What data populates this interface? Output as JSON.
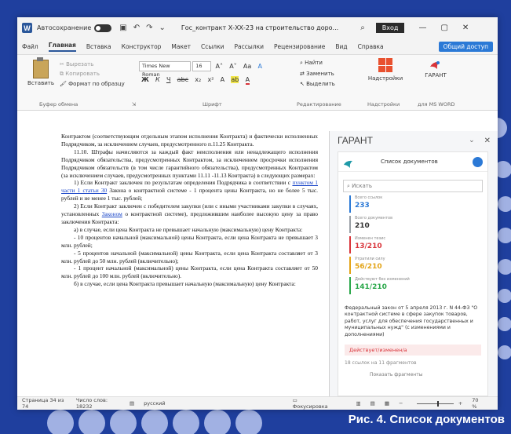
{
  "title_bar": {
    "autosave_label": "Автосохранение",
    "doc_title": "Гос_контракт Х-ХХ-23 на строительство доро...",
    "login_label": "Вход"
  },
  "menu": {
    "items": [
      "Файл",
      "Главная",
      "Вставка",
      "Конструктор",
      "Макет",
      "Ссылки",
      "Рассылки",
      "Рецензирование",
      "Вид",
      "Справка"
    ],
    "share_label": "Общий доступ"
  },
  "ribbon": {
    "paste_label": "Вставить",
    "cut_label": "Вырезать",
    "copy_label": "Копировать",
    "format_painter_label": "Формат по образцу",
    "font_name": "Times New Roman",
    "font_size": "16",
    "find_label": "Найти",
    "replace_label": "Заменить",
    "select_label": "Выделить",
    "addins_label": "Надстройки",
    "garant_label": "ГАРАНТ",
    "groups": {
      "clipboard": "Буфер обмена",
      "font": "Шрифт",
      "editing": "Редактирование",
      "addins": "Надстройки",
      "garant": "для MS WORD"
    }
  },
  "document": {
    "paragraphs": [
      "Контрактом (соответствующим отдельным этапом исполнения Контракта) и фактически исполненных Подрядчиком, за исключением случаев, предусмотренного п.11.25 Контракта.",
      "11.10. Штрафы начисляются за каждый факт неисполнения или ненадлежащего исполнения Подрядчиком обязательства, предусмотренных Контрактом, за исключением просрочки исполнения Подрядчиком обязательств (в том числе гарантийного обязательства), предусмотренных Контрактом (за исключением случаев, предусмотренных пунктами 11.11 -11.13 Контракта) в следующих размерах:",
      "1) Если Контракт заключен по результатам определения Подрядчика в соответствии с",
      "пунктом 1 части 1 статьи 30",
      " Закона о контрактной системе - 1 процента цены Контракта, но не более 5 тыс. рублей и не менее 1 тыс. рублей;",
      "2) Если Контракт заключен с победителем закупки (или с иными участниками закупки в случаях, установленных ",
      "Законом",
      " о контрактной системе), предложившим наиболее высокую цену за право заключения Контракта:",
      "а) в случае, если цена Контракта не превышает начальную (максимальную) цену Контракта:",
      "- 10 процентов начальной (максимальной) цены Контракта, если цена Контракта не превышает 3 млн. рублей;",
      "- 5 процентов начальной (максимальной) цены Контракта, если цена Контракта составляет от 3 млн. рублей до 50 млн. рублей (включительно);",
      "- 1 процент начальной (максимальной) цены Контракта, если цена Контракта составляет от 50 млн. рублей до 100 млн. рублей (включительно).",
      "б) в случае, если цена Контракта превышает начальную (максимальную) цену Контракта:"
    ]
  },
  "garant_panel": {
    "title": "ГАРАНТ",
    "card_title": "Список документов",
    "search_placeholder": "Искать",
    "stats": [
      {
        "label": "Всего ссылок",
        "value": "233",
        "color": "#2b79d6"
      },
      {
        "label": "Всего документов",
        "value": "210",
        "color": "#9aa0a6"
      },
      {
        "label": "Изменен тезис",
        "value": "13/210",
        "color": "#d9343a"
      },
      {
        "label": "Утратили силу",
        "value": "56/210",
        "color": "#e3a417"
      },
      {
        "label": "Действуют без изменений",
        "value": "141/210",
        "color": "#2aa84a"
      }
    ],
    "description": "Федеральный закон от 5 апреля 2013 г. N 44-ФЗ \"О контрактной системе в сфере закупок товаров, работ, услуг для обеспечения государственных и муниципальных нужд\" (с изменениями и дополнениями)",
    "action_label": "Действует/изменен/а",
    "count_label": "18 ссылок на 11 фрагментов",
    "more_label": "Показать фрагменты"
  },
  "status_bar": {
    "page": "Страница 34 из 74",
    "words": "Число слов: 18232",
    "language": "русский",
    "focus": "Фокусировка",
    "zoom": "70 %"
  },
  "caption": "Рис. 4. Список документов"
}
